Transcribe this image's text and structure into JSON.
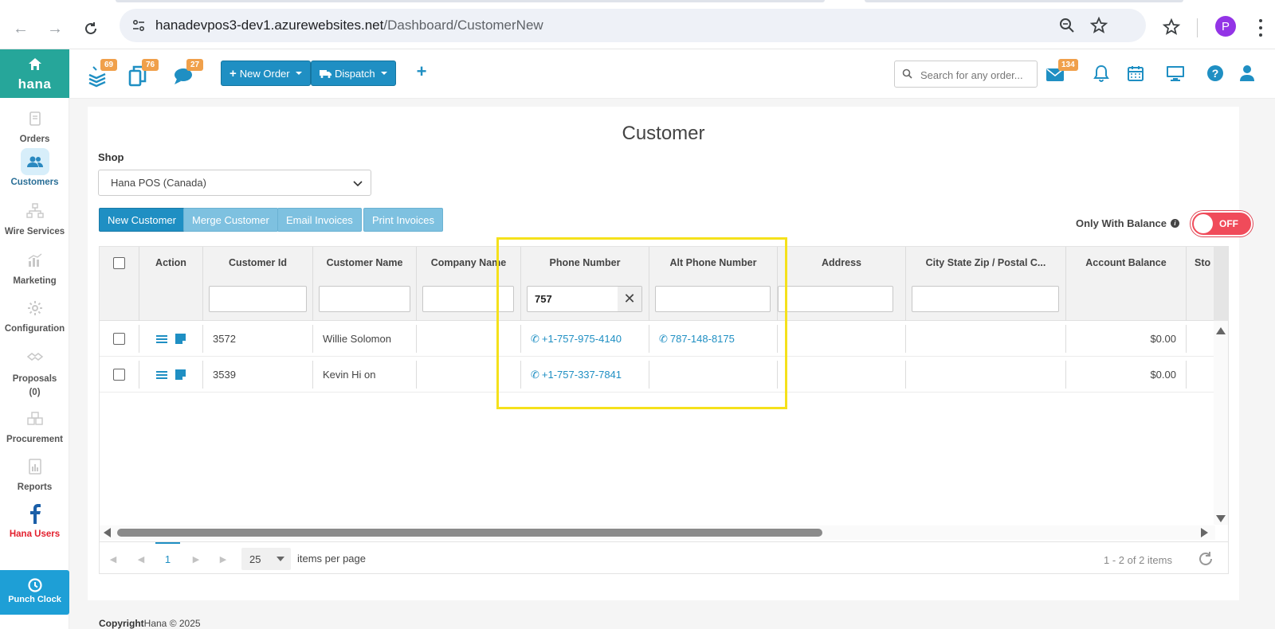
{
  "browser": {
    "url_host": "hanadevpos3-dev1.azurewebsites.net",
    "url_path": "/Dashboard/CustomerNew",
    "profile_initial": "P"
  },
  "sidebar": {
    "logo": "hana",
    "items": [
      {
        "label": "Orders"
      },
      {
        "label": "Customers"
      },
      {
        "label": "Wire Services"
      },
      {
        "label": "Marketing"
      },
      {
        "label": "Configuration"
      },
      {
        "label": "Proposals\n(0)"
      },
      {
        "label": "Procurement"
      },
      {
        "label": "Reports"
      },
      {
        "label": "Hana Users"
      }
    ],
    "punch_clock": "Punch Clock"
  },
  "topbar": {
    "badges": {
      "orders": "69",
      "copies": "76",
      "chat": "27",
      "mail": "134"
    },
    "new_order": "New Order",
    "dispatch": "Dispatch",
    "search_placeholder": "Search for any order..."
  },
  "page": {
    "title": "Customer",
    "shop_label": "Shop",
    "shop_value": "Hana POS (Canada)",
    "buttons": {
      "new_customer": "New Customer",
      "merge_customer": "Merge Customer",
      "email_invoices": "Email Invoices",
      "print_invoices": "Print Invoices"
    },
    "balance_label": "Only With Balance",
    "toggle_label": "OFF"
  },
  "grid": {
    "columns": [
      "Action",
      "Customer Id",
      "Customer Name",
      "Company Name",
      "Phone Number",
      "Alt Phone Number",
      "Address",
      "City State Zip / Postal C...",
      "Account Balance",
      "Sto"
    ],
    "filter_phone": "757",
    "rows": [
      {
        "customer_id": "3572",
        "name": "Willie Solomon",
        "company": "",
        "phone": "+1-757-975-4140",
        "alt_phone": "787-148-8175",
        "balance": "$0.00"
      },
      {
        "customer_id": "3539",
        "name": "Kevin Hi on",
        "company": "",
        "phone": "+1-757-337-7841",
        "alt_phone": "",
        "balance": "$0.00"
      }
    ],
    "pager": {
      "page": "1",
      "page_size": "25",
      "items_per_page": "items per page",
      "info": "1 - 2 of 2 items"
    }
  },
  "footer": {
    "copyright": "Copyright",
    "brand": "Hana © 2025"
  },
  "colors": {
    "brand_teal": "#26a69a",
    "primary_blue": "#1f8fc3",
    "badge_orange": "#f0a04b",
    "toggle_red": "#f04b5a",
    "highlight_yellow": "#f5e11b"
  }
}
